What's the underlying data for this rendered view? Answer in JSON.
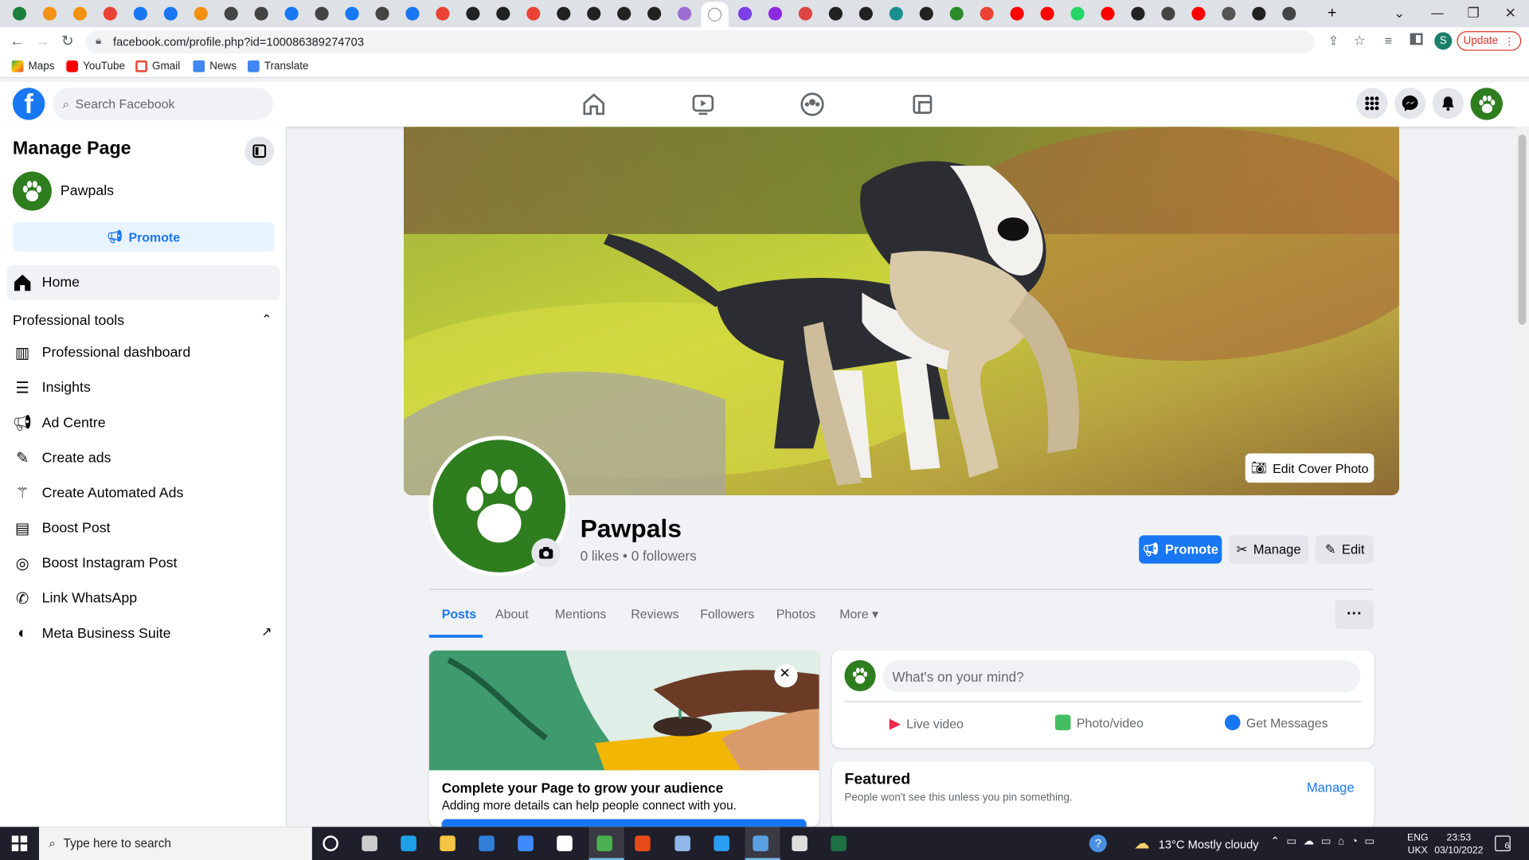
{
  "browser": {
    "url": "facebook.com/profile.php?id=100086389274703",
    "update_label": "Update",
    "profile_initial": "S",
    "bookmarks": [
      "Maps",
      "YouTube",
      "Gmail",
      "News",
      "Translate"
    ]
  },
  "header": {
    "search_placeholder": "Search Facebook"
  },
  "sidebar": {
    "title": "Manage Page",
    "page_name": "Pawpals",
    "promote_label": "Promote",
    "home_label": "Home",
    "section_label": "Professional tools",
    "items": [
      {
        "label": "Professional dashboard",
        "icon": "dashboard-icon"
      },
      {
        "label": "Insights",
        "icon": "insights-icon"
      },
      {
        "label": "Ad Centre",
        "icon": "megaphone-icon"
      },
      {
        "label": "Create ads",
        "icon": "pencil-icon"
      },
      {
        "label": "Create Automated Ads",
        "icon": "magic-wand-icon"
      },
      {
        "label": "Boost Post",
        "icon": "boost-post-icon"
      },
      {
        "label": "Boost Instagram Post",
        "icon": "instagram-icon"
      },
      {
        "label": "Link WhatsApp",
        "icon": "whatsapp-icon"
      },
      {
        "label": "Meta Business Suite",
        "icon": "meta-business-icon"
      }
    ]
  },
  "profile": {
    "edit_cover_label": "Edit Cover Photo",
    "name": "Pawpals",
    "stats": "0 likes • 0 followers",
    "promote_label": "Promote",
    "manage_label": "Manage",
    "edit_label": "Edit",
    "tabs": [
      "Posts",
      "About",
      "Mentions",
      "Reviews",
      "Followers",
      "Photos",
      "More"
    ],
    "more_dots": "···"
  },
  "cards": {
    "grow_title": "Complete your Page to grow your audience",
    "grow_subtitle": "Adding more details can help people connect with you.",
    "composer_placeholder": "What's on your mind?",
    "live_video": "Live video",
    "photo_video": "Photo/video",
    "get_messages": "Get Messages",
    "featured_title": "Featured",
    "featured_subtitle": "People won't see this unless you pin something.",
    "featured_manage": "Manage"
  },
  "taskbar": {
    "search_placeholder": "Type here to search",
    "weather": "13°C  Mostly cloudy",
    "lang1": "ENG",
    "lang2": "UKX",
    "time": "23:53",
    "date": "03/10/2022",
    "notif_count": "6"
  },
  "colors": {
    "fb_blue": "#1877f2",
    "paw_green": "#2e7d1e"
  }
}
